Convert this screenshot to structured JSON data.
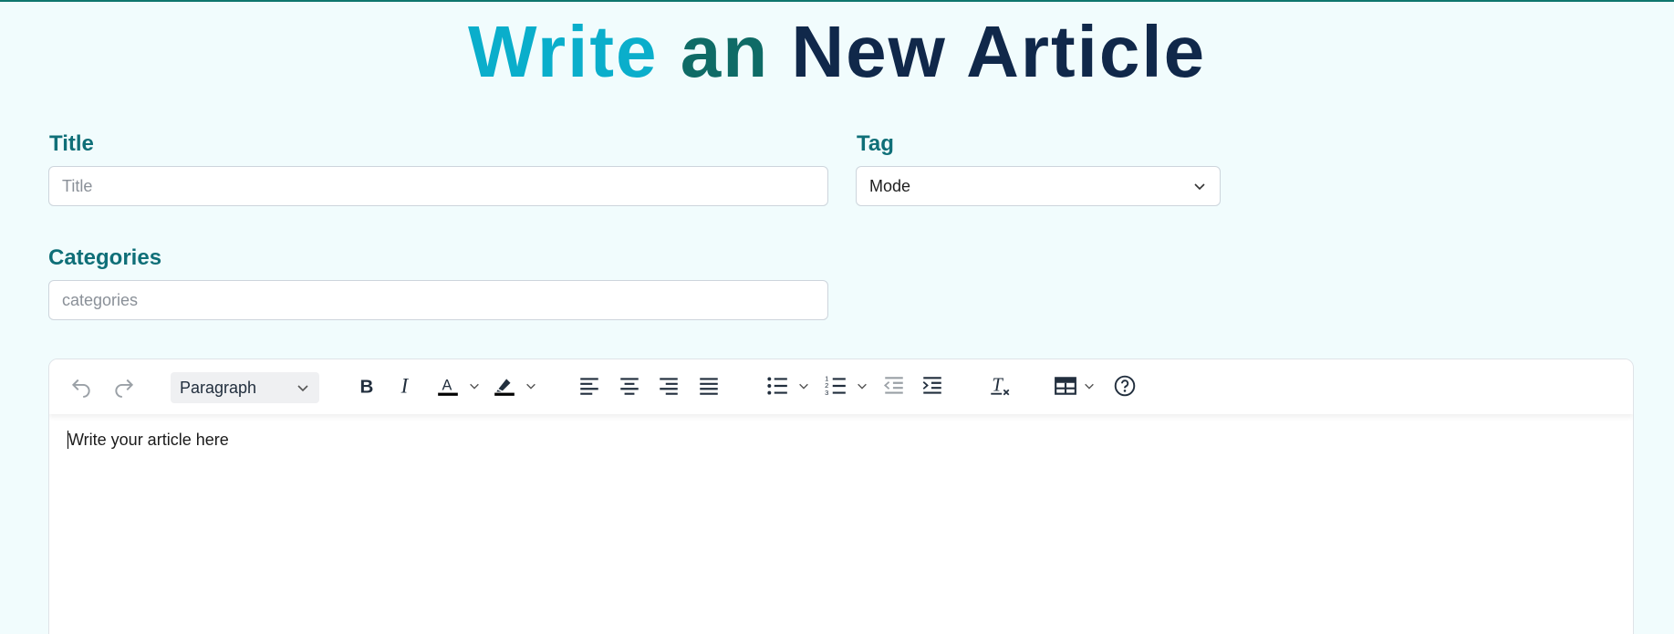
{
  "heading": {
    "word1": "Write",
    "word2": "an",
    "word3": "New Article",
    "colors": {
      "word1": "#0aaecb",
      "word2": "#0f6b66",
      "word3": "#10284a"
    }
  },
  "form": {
    "title": {
      "label": "Title",
      "placeholder": "Title",
      "value": ""
    },
    "tag": {
      "label": "Tag",
      "selected": "Mode"
    },
    "categories": {
      "label": "Categories",
      "placeholder": "categories",
      "value": ""
    }
  },
  "editor": {
    "block_format": "Paragraph",
    "toolbar_icons": [
      "undo-icon",
      "redo-icon",
      "bold-icon",
      "italic-icon",
      "text-color-icon",
      "highlight-icon",
      "align-left-icon",
      "align-center-icon",
      "align-right-icon",
      "align-justify-icon",
      "bullet-list-icon",
      "numbered-list-icon",
      "outdent-icon",
      "indent-icon",
      "clear-formatting-icon",
      "table-icon",
      "help-icon"
    ],
    "placeholder": "Write your article here"
  },
  "colors": {
    "page_background": "#f1fcfd",
    "label": "#0f6f78",
    "accent_top_border": "#0f766e"
  }
}
